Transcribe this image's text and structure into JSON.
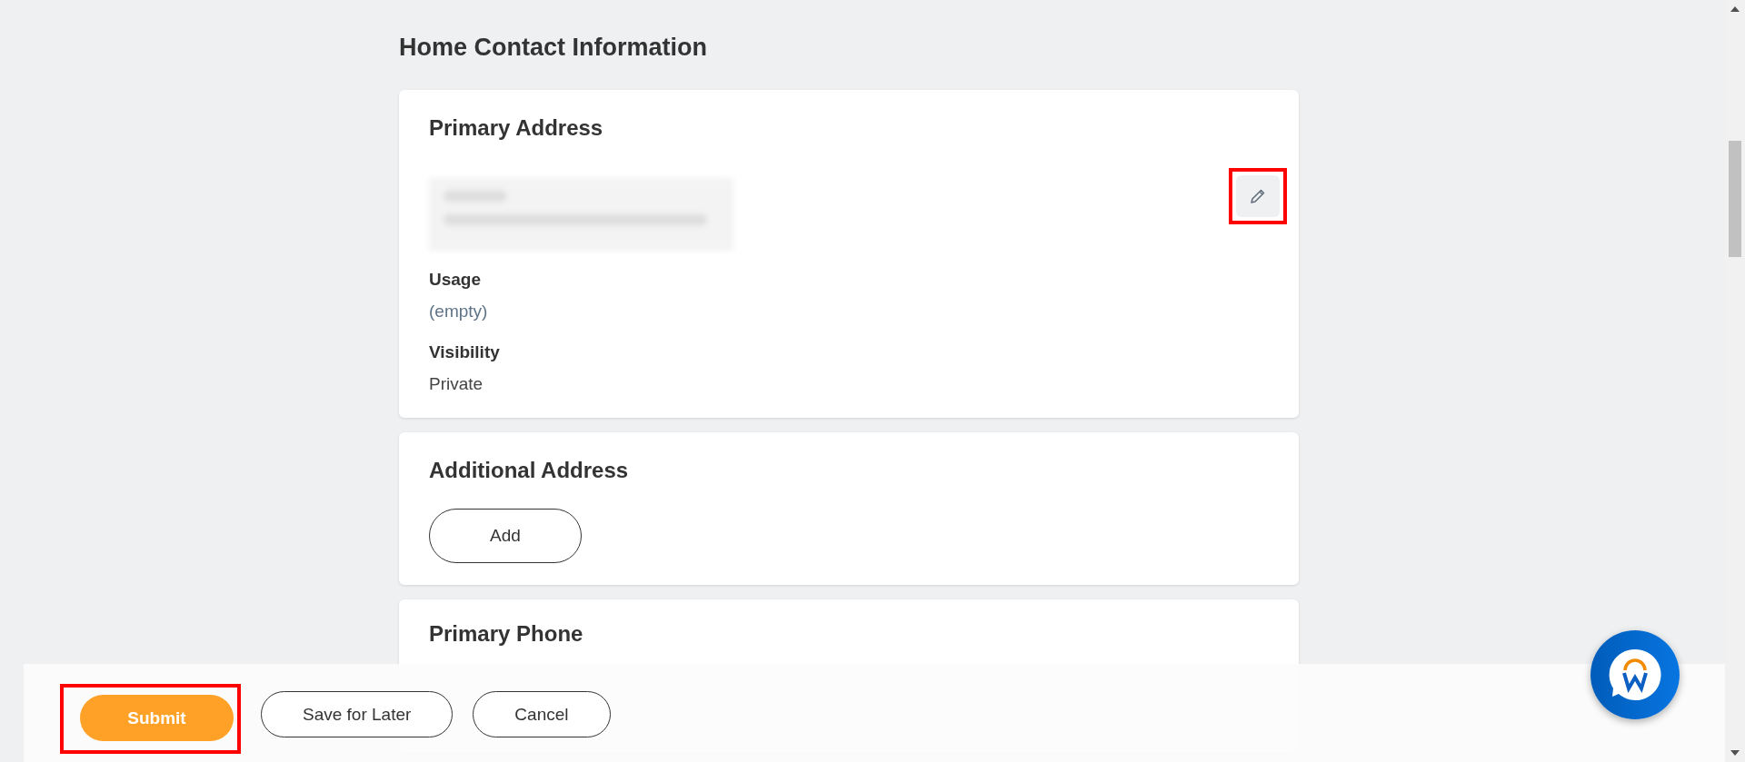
{
  "page_title": "Home Contact Information",
  "primary_address": {
    "title": "Primary Address",
    "edit_highlighted": true,
    "fields": [
      {
        "label": "Usage",
        "value": "(empty)",
        "empty": true
      },
      {
        "label": "Visibility",
        "value": "Private",
        "empty": false
      }
    ]
  },
  "additional_address": {
    "title": "Additional Address",
    "button": "Add"
  },
  "primary_phone": {
    "title": "Primary Phone"
  },
  "actions": [
    {
      "label": "Submit",
      "kind": "primary",
      "highlighted": true
    },
    {
      "label": "Save for Later",
      "kind": "secondary",
      "highlighted": false
    },
    {
      "label": "Cancel",
      "kind": "secondary",
      "highlighted": false
    }
  ]
}
